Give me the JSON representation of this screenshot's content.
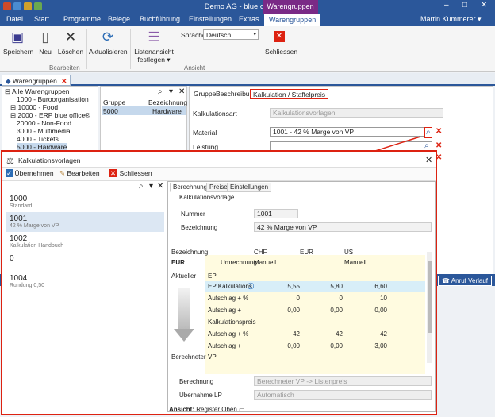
{
  "window": {
    "title": "Demo AG - blue office 4.1",
    "context_tab": "Warengruppen",
    "min": "–",
    "max": "□",
    "close": "✕"
  },
  "menu": {
    "items": [
      "Datei",
      "Start",
      "Programme",
      "Belege",
      "Buchführung",
      "Einstellungen",
      "Extras",
      "Warengruppen"
    ],
    "user": "Martin Kummerer ▾"
  },
  "ribbon": {
    "save": "Speichern",
    "new": "Neu",
    "delete": "Löschen",
    "refresh": "Aktualisieren",
    "listview": "Listenansicht festlegen",
    "language_label": "Sprache",
    "language_value": "Deutsch",
    "close": "Schliessen",
    "group_bearbeiten": "Bearbeiten",
    "group_ansicht": "Ansicht"
  },
  "doc_tab": {
    "label": "Warengruppen"
  },
  "tree": {
    "items": [
      "Alle Warengruppen",
      "1000 - Buroorganisation",
      "10000 - Food",
      "2000 - ERP blue office®",
      "20000 - Non-Food",
      "3000 - Multimedia",
      "4000 - Tickets",
      "5000 - Hardware"
    ]
  },
  "group_list": {
    "col1": "Gruppe",
    "col2": "Bezeichnung",
    "row_code": "5000",
    "row_name": "Hardware"
  },
  "detail": {
    "tabs": [
      "Gruppe",
      "Beschreibung",
      "Kalkulation / Staffelpreis"
    ],
    "kalkulationsart_label": "Kalkulationsart",
    "kalkulationsart_value": "Kalkulationsvorlagen",
    "material_label": "Material",
    "material_value": "1001 - 42 % Marge von VP",
    "leistung_label": "Leistung"
  },
  "status": {
    "anruf": "Anruf Verlauf"
  },
  "dialog": {
    "title": "Kalkulationsvorlagen",
    "toolbar": {
      "apply": "Übernehmen",
      "edit": "Bearbeiten",
      "close": "Schliessen"
    },
    "list": [
      {
        "code": "1000",
        "desc": "Standard"
      },
      {
        "code": "1001",
        "desc": "42 % Marge von VP"
      },
      {
        "code": "1002",
        "desc": "Kalkulation Handbuch"
      },
      {
        "code": "0",
        "desc": ""
      },
      {
        "code": "1004",
        "desc": "Rundung 0,50"
      }
    ],
    "tabs": [
      "Berechnung",
      "Preise",
      "Einstellungen"
    ],
    "vorlage_group": "Kalkulationsvorlage",
    "nummer_label": "Nummer",
    "nummer_value": "1001",
    "bezeichnung_label": "Bezeichnung",
    "bezeichnung_value": "42 % Marge von VP",
    "grid": {
      "bezeichnung": "Bezeichnung",
      "currencies": [
        "CHF",
        "EUR",
        "US"
      ],
      "eur": "EUR",
      "umrechnung": "Umrechnung",
      "umrechnung_values": [
        "Manuell",
        "Manuell"
      ],
      "aktueller": "Aktueller",
      "ep": "EP",
      "rows": [
        {
          "label": "EP Kalkulations",
          "values": [
            "5,55",
            "5,80",
            "6,60"
          ]
        },
        {
          "label": "Aufschlag + %",
          "values": [
            "0",
            "0",
            "10"
          ]
        },
        {
          "label": "Aufschlag +",
          "values": [
            "0,00",
            "0,00",
            "0,00"
          ]
        },
        {
          "label": "Kalkulationspreis",
          "values": [
            "",
            "",
            ""
          ]
        },
        {
          "label": "Aufschlag + %",
          "values": [
            "42",
            "42",
            "42"
          ]
        },
        {
          "label": "Aufschlag +",
          "values": [
            "0,00",
            "0,00",
            "3,00"
          ]
        }
      ],
      "berechneter": "Berechneter",
      "vp": "VP"
    },
    "berechnung_label": "Berechnung",
    "berechnung_value": "Berechneter VP -> Listenpreis",
    "uebernahme_label": "Übernahme LP",
    "uebernahme_value": "Automatisch",
    "ansicht_label": "Ansicht:",
    "ansicht_value": "Register Oben"
  }
}
